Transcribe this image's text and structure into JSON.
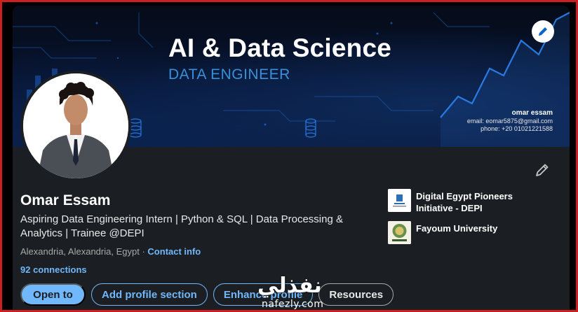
{
  "banner": {
    "title": "AI & Data Science",
    "subtitle": "DATA ENGINEER",
    "contact_name": "omar essam",
    "contact_email": "email: eomar5875@gmail.com",
    "contact_phone": "phone: +20 01021221588"
  },
  "profile": {
    "name": "Omar Essam",
    "headline": "Aspiring Data Engineering Intern | Python & SQL | Data Processing & Analytics | Trainee @DEPI",
    "location": "Alexandria, Alexandria, Egypt",
    "location_separator": "·",
    "contact_info": "Contact info",
    "connections": "92 connections"
  },
  "organizations": [
    {
      "name": "Digital Egypt Pioneers Initiative - DEPI"
    },
    {
      "name": "Fayoum University"
    }
  ],
  "actions": {
    "open_to": "Open to",
    "add_section": "Add profile section",
    "enhance": "Enhance profile",
    "resources": "Resources"
  },
  "watermark": {
    "arabic": "نفذلي",
    "latin": "nafezly.com"
  },
  "icons": {
    "edit_cover": "pencil-icon",
    "edit_intro": "pencil-icon"
  },
  "colors": {
    "accent": "#71b7fb",
    "card_bg": "#1b1f23",
    "frame": "#cc1f1f"
  }
}
